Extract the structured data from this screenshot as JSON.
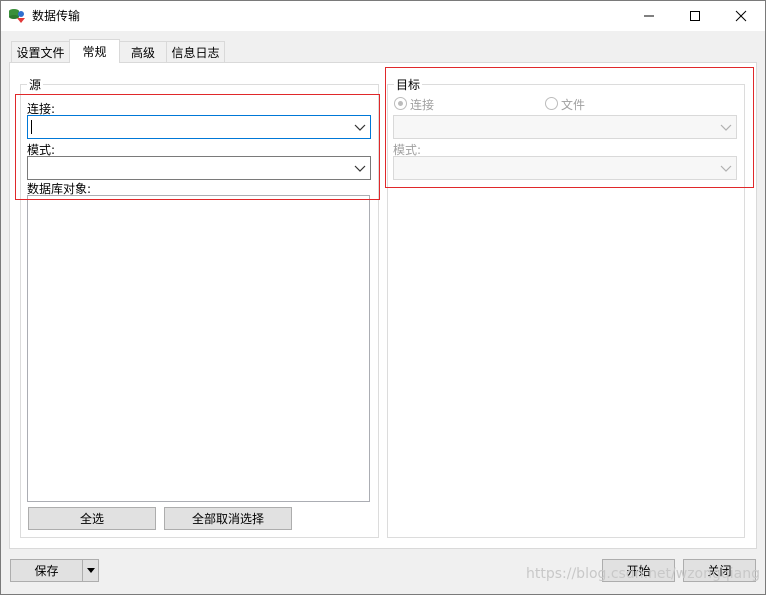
{
  "window": {
    "title": "数据传输"
  },
  "tabs": [
    {
      "label": "设置文件"
    },
    {
      "label": "常规"
    },
    {
      "label": "高级"
    },
    {
      "label": "信息日志"
    }
  ],
  "source": {
    "group_label": "源",
    "connection_label": "连接:",
    "connection_value": "",
    "schema_label": "模式:",
    "schema_value": "",
    "objects_label": "数据库对象:",
    "select_all_label": "全选",
    "deselect_all_label": "全部取消选择"
  },
  "target": {
    "group_label": "目标",
    "radio_connection_label": "连接",
    "radio_file_label": "文件",
    "connection_value": "",
    "schema_label": "模式:",
    "schema_value": ""
  },
  "footer": {
    "save_label": "保存",
    "start_label": "开始",
    "close_label": "关闭"
  },
  "watermark": "https://blog.csdn.net/wzongqiang",
  "colors": {
    "highlight_border": "#e0282a",
    "focus_border": "#0078d7",
    "panel_bg": "#ffffff",
    "window_bg": "#f0f0f0"
  }
}
